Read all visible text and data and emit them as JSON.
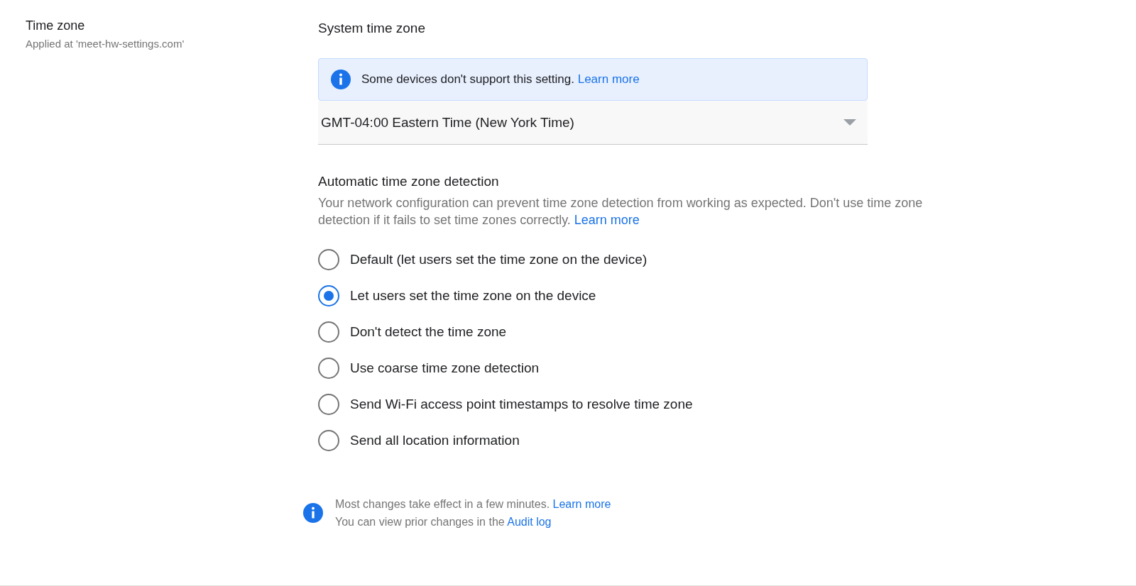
{
  "section": {
    "title": "Time zone",
    "subtitle": "Applied at 'meet-hw-settings.com'"
  },
  "system_time_zone": {
    "label": "System time zone",
    "notice": {
      "text": "Some devices don't support this setting.",
      "link": "Learn more"
    },
    "select": {
      "value": "GMT-04:00 Eastern Time (New York Time)"
    }
  },
  "detection": {
    "title": "Automatic time zone detection",
    "description": "Your network configuration can prevent time zone detection from working as expected. Don't use time zone detection if it fails to set time zones correctly.",
    "link": "Learn more",
    "options": [
      {
        "label": "Default (let users set the time zone on the device)",
        "selected": false
      },
      {
        "label": "Let users set the time zone on the device",
        "selected": true
      },
      {
        "label": "Don't detect the time zone",
        "selected": false
      },
      {
        "label": "Use coarse time zone detection",
        "selected": false
      },
      {
        "label": "Send Wi-Fi access point timestamps to resolve time zone",
        "selected": false
      },
      {
        "label": "Send all location information",
        "selected": false
      }
    ]
  },
  "footer": {
    "lines": [
      {
        "text": "Most changes take effect in a few minutes.",
        "link": "Learn more"
      },
      {
        "text": "You can view prior changes in the",
        "link": "Audit log"
      }
    ]
  }
}
